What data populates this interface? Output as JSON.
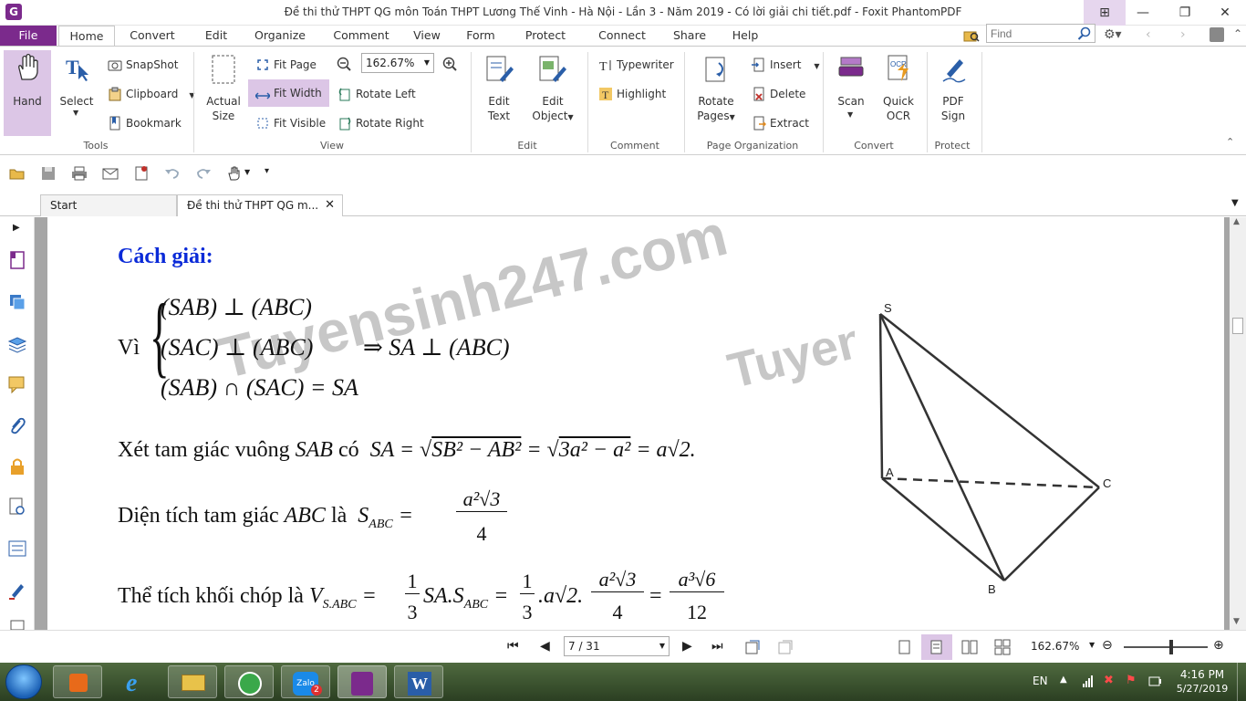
{
  "window": {
    "title": "Đề thi thử THPT QG môn Toán THPT Lương Thế Vinh - Hà Nội - Lần 3 - Năm 2019 - Có lời giải chi tiết.pdf - Foxit PhantomPDF",
    "app_icon": "G"
  },
  "menu": {
    "file": "File",
    "home": "Home",
    "convert": "Convert",
    "edit": "Edit",
    "organize": "Organize",
    "comment": "Comment",
    "view": "View",
    "form": "Form",
    "protect": "Protect",
    "connect": "Connect",
    "share": "Share",
    "help": "Help"
  },
  "search": {
    "placeholder": "Find"
  },
  "ribbon": {
    "tools": {
      "hand": "Hand",
      "select": "Select",
      "snapshot": "SnapShot",
      "clipboard": "Clipboard",
      "bookmark": "Bookmark",
      "label": "Tools"
    },
    "view": {
      "actual_size_1": "Actual",
      "actual_size_2": "Size",
      "fit_page": "Fit Page",
      "fit_width": "Fit Width",
      "fit_visible": "Fit Visible",
      "zoom": "162.67%",
      "rotate_left": "Rotate Left",
      "rotate_right": "Rotate Right",
      "label": "View"
    },
    "edit": {
      "edit_text_1": "Edit",
      "edit_text_2": "Text",
      "edit_object_1": "Edit",
      "edit_object_2": "Object",
      "label": "Edit"
    },
    "comment": {
      "typewriter": "Typewriter",
      "highlight": "Highlight",
      "label": "Comment"
    },
    "page_org": {
      "rotate_pages_1": "Rotate",
      "rotate_pages_2": "Pages",
      "insert": "Insert",
      "delete": "Delete",
      "extract": "Extract",
      "label": "Page Organization"
    },
    "convert": {
      "scan": "Scan",
      "quick_ocr_1": "Quick",
      "quick_ocr_2": "OCR",
      "label": "Convert"
    },
    "protect": {
      "pdf_sign_1": "PDF",
      "pdf_sign_2": "Sign",
      "label": "Protect"
    }
  },
  "tabs": [
    {
      "label": "Start"
    },
    {
      "label": "Đề thi thử THPT QG m..."
    }
  ],
  "document": {
    "heading": "Cách giải:",
    "vi": "Vì",
    "sys1": "(SAB) ⊥ (ABC)",
    "sys2": "(SAC) ⊥ (ABC)",
    "sys3": "(SAB) ∩ (SAC) = SA",
    "implies": "⇒ SA ⊥ (ABC)",
    "line2_text": "Xét tam giác vuông",
    "line2_sab": "SAB",
    "line2_co": "có",
    "line3_text": "Diện tích tam giác",
    "line3_abc": "ABC",
    "line3_la": "là",
    "line4_text": "Thể tích khối chóp là",
    "watermark": "Tuyensinh247.com",
    "watermark2": "Tuyens",
    "fig_labels": {
      "s": "S",
      "a": "A",
      "b": "B",
      "c": "C"
    }
  },
  "status": {
    "page": "7 / 31",
    "zoom": "162.67%"
  },
  "taskbar": {
    "lang": "EN",
    "time": "4:16 PM",
    "date": "5/27/2019",
    "zalo_badge": "2"
  }
}
